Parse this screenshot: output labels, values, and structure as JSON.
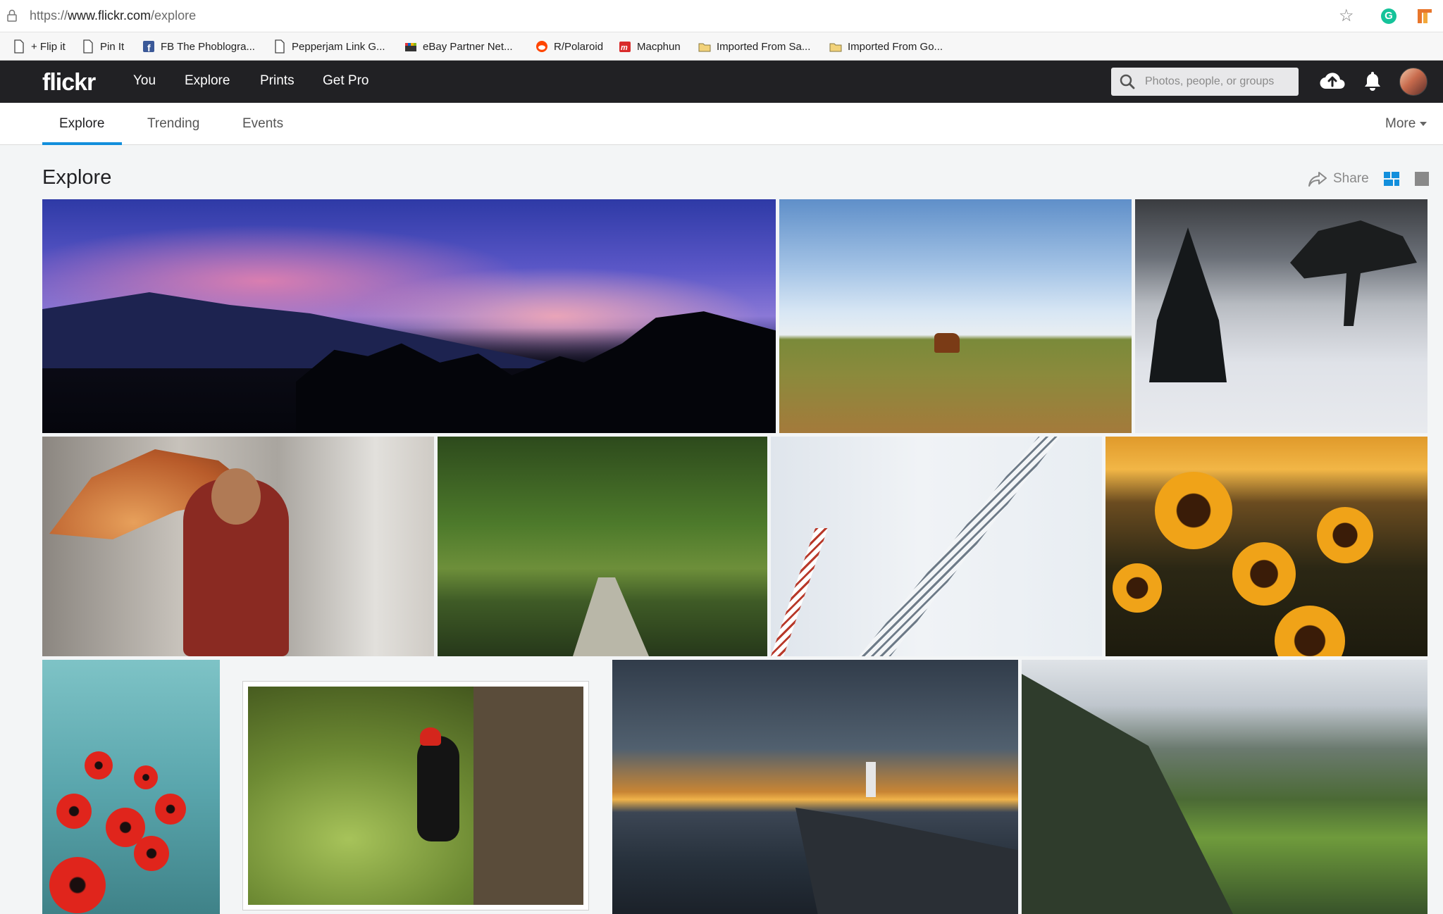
{
  "browser": {
    "url_prefix": "https://",
    "url_host": "www.flickr.com",
    "url_path": "/explore",
    "extensions": [
      "grammarly-icon",
      "pepperjam-icon"
    ]
  },
  "bookmarks": [
    {
      "label": "+ Flip it",
      "icon": "page-icon"
    },
    {
      "label": "Pin It",
      "icon": "page-icon"
    },
    {
      "label": "FB The Phoblogra...",
      "icon": "facebook-icon"
    },
    {
      "label": "Pepperjam Link G...",
      "icon": "page-icon"
    },
    {
      "label": "eBay Partner Net...",
      "icon": "ebay-icon"
    },
    {
      "label": "R/Polaroid",
      "icon": "reddit-icon"
    },
    {
      "label": "Macphun",
      "icon": "macphun-icon"
    },
    {
      "label": "Imported From Sa...",
      "icon": "folder-icon"
    },
    {
      "label": "Imported From Go...",
      "icon": "folder-icon"
    }
  ],
  "nav": {
    "logo": "flickr",
    "links": [
      "You",
      "Explore",
      "Prints",
      "Get Pro"
    ],
    "search_placeholder": "Photos, people, or groups"
  },
  "subnav": {
    "tabs": [
      "Explore",
      "Trending",
      "Events"
    ],
    "active": "Explore",
    "more": "More"
  },
  "content": {
    "title": "Explore",
    "share": "Share"
  },
  "colors": {
    "topbar": "#212124",
    "accent": "#128fdc",
    "grey_icon": "#898989"
  }
}
